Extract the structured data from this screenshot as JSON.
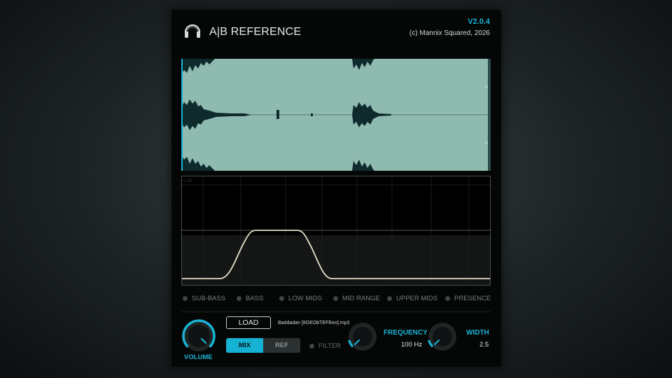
{
  "header": {
    "title": "A|B REFERENCE",
    "version": "V2.0.4",
    "copyright": "(c) Mannix Squared, 2026",
    "logo_icon": "headphones-icon"
  },
  "eq_display": {
    "scale_label": "0 dB"
  },
  "bands": [
    {
      "label": "SUB-BASS"
    },
    {
      "label": "BASS"
    },
    {
      "label": "LOW MIDS"
    },
    {
      "label": "MID RANGE"
    },
    {
      "label": "UPPER MIDS"
    },
    {
      "label": "PRESENCE"
    }
  ],
  "controls": {
    "volume": {
      "label": "VOLUME"
    },
    "load_label": "LOAD",
    "filename": "Baddadan [8GEObTEFEeo].mp3",
    "mix_label": "MIX",
    "ref_label": "REF",
    "mix_active": true,
    "filter_label": "FILTER",
    "frequency": {
      "label": "FREQUENCY",
      "value": "100 Hz"
    },
    "width": {
      "label": "WIDTH",
      "value": "2.5"
    }
  },
  "colors": {
    "accent": "#19b3d6",
    "waveform_bg": "#8fbab0",
    "waveform_fg": "#0e2a2c",
    "eq_curve": "#e8e2c8"
  }
}
